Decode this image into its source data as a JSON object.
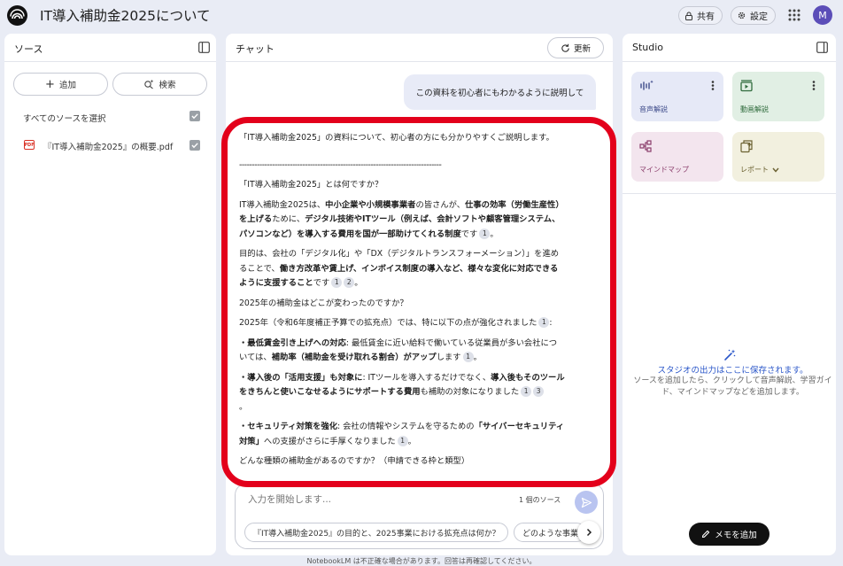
{
  "app": {
    "title": "IT導入補助金2025について",
    "avatar_letter": "M"
  },
  "header": {
    "share_label": "共有",
    "settings_label": "設定"
  },
  "sources_panel": {
    "title": "ソース",
    "add_label": "追加",
    "search_label": "検索",
    "select_all_label": "すべてのソースを選択",
    "select_all_checked": true,
    "items": [
      {
        "name": "『IT導入補助金2025』の概要.pdf",
        "type": "PDF",
        "checked": true
      }
    ]
  },
  "chat_panel": {
    "title": "チャット",
    "refresh_label": "更新",
    "user_message": "この資料を初心者にもわかるように説明して",
    "answer": {
      "intro": "「IT導入補助金2025」の資料について、初心者の方にも分かりやすくご説明します。",
      "divider": "--------------------------------------------------------------------------------",
      "q1": "「IT導入補助金2025」とは何ですか？",
      "p1_a": "IT導入補助金2025は、",
      "p1_b": "中小企業や小規模事業者",
      "p1_c": "の皆さんが、",
      "p1_d": "仕事の効率（労働生産性）を上げる",
      "p1_e": "ために、",
      "p1_f": "デジタル技術やITツール（例えば、会計ソフトや顧客管理システム、パソコンなど）を導入する費用を国が一部助けてくれる制度",
      "p1_g": "です",
      "p2_a": "目的は、会社の「デジタル化」や「DX（デジタルトランスフォーメーション）」を進めることで、",
      "p2_b": "働き方改革や賃上げ、インボイス制度の導入など、様々な変化に対応できるように支援すること",
      "p2_c": "です",
      "p2_end": "。",
      "q2": "2025年の補助金はどこが変わったのですか？",
      "p3": "2025年（令和6年度補正予算での拡充点）では、特に以下の点が強化されました",
      "p3_colon": ":",
      "b1_a": "・最低賃金引き上げへの対応",
      "b1_b": ": 最低賃金に近い給料で働いている従業員が多い会社については、",
      "b1_c": "補助率（補助金を受け取れる割合）がアップ",
      "b1_d": "します",
      "b2_a": "・導入後の「活用支援」も対象に",
      "b2_b": ": ITツールを導入するだけでなく、",
      "b2_c": "導入後もそのツールをきちんと使いこなせるようにサポートする費用",
      "b2_d": "も補助の対象になりました",
      "b2_end": "。",
      "b3_a": "・セキュリティ対策を強化",
      "b3_b": ": 会社の情報やシステムを守るための",
      "b3_c": "「サイバーセキュリティ対策」",
      "b3_d": "への支援がさらに手厚くなりました",
      "b3_end": "。",
      "q3": "どんな種類の補助金があるのですか？（申請できる枠と類型）",
      "citations": {
        "c1": "1",
        "c2": "2",
        "c3": "3"
      }
    },
    "input_placeholder": "入力を開始します...",
    "source_count": "1 個のソース",
    "suggestions": [
      "『IT導入補助金2025』の目的と、2025事業における拡充点は何か？",
      "どのような事業者"
    ]
  },
  "studio_panel": {
    "title": "Studio",
    "tiles": [
      {
        "label": "音声解説",
        "color": "#e6e9f7",
        "label_color": "#3d4a8a"
      },
      {
        "label": "動画解説",
        "color": "#e1efe4",
        "label_color": "#2f6b3c"
      },
      {
        "label": "マインドマップ",
        "color": "#f3e5ee",
        "label_color": "#8a3d6b"
      },
      {
        "label": "レポート",
        "color": "#f2f0df",
        "label_color": "#6b6131"
      }
    ],
    "empty_title": "スタジオの出力はここに保存されます。",
    "empty_desc": "ソースを追加したら、クリックして音声解説、学習ガイド、マインドマップなどを追加します。",
    "add_note_label": "メモを追加"
  },
  "footer": {
    "disclaimer": "NotebookLM は不正確な場合があります。回答は再確認してください。"
  },
  "colors": {
    "background": "#e9ecf5",
    "highlight_border": "#e3001b",
    "accent_blue": "#2b57c9"
  }
}
